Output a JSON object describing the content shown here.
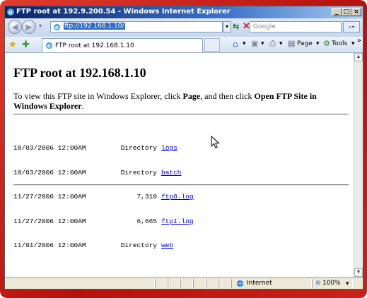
{
  "window": {
    "title": "FTP root at 192.9.200.54 - Windows Internet Explorer",
    "caption_buttons": {
      "minimize": "_",
      "maximize": "□",
      "close": "×"
    }
  },
  "toolbar": {
    "address": "ftp://192.168.1.10/",
    "search_placeholder": "Google",
    "tab_title": "FTP root at 192.168.1.10",
    "page_label": "Page",
    "tools_label": "Tools",
    "overflow": "»"
  },
  "page": {
    "heading": "FTP root at 192.168.1.10",
    "intro_prefix": "To view this FTP site in Windows Explorer, click ",
    "intro_page": "Page",
    "intro_middle": ", and then click ",
    "intro_open": "Open FTP Site in Windows Explorer",
    "intro_suffix": "."
  },
  "listing": [
    {
      "datetime": "10/03/2006 12:00AM",
      "info": "Directory",
      "name": "logs"
    },
    {
      "datetime": "10/03/2006 12:00AM",
      "info": "Directory",
      "name": "batch"
    },
    {
      "datetime": "11/27/2006 12:00AM",
      "info": "7,310",
      "name": "ftp0.log"
    },
    {
      "datetime": "11/27/2006 12:00AM",
      "info": "6,665",
      "name": "ftp1.log"
    },
    {
      "datetime": "11/01/2006 12:00AM",
      "info": "Directory",
      "name": "web"
    }
  ],
  "status": {
    "zone": "Internet",
    "zoom": "100%"
  },
  "colors": {
    "frame": "#c0140e",
    "titlebar": "#0a246a",
    "link": "#0000ee"
  }
}
